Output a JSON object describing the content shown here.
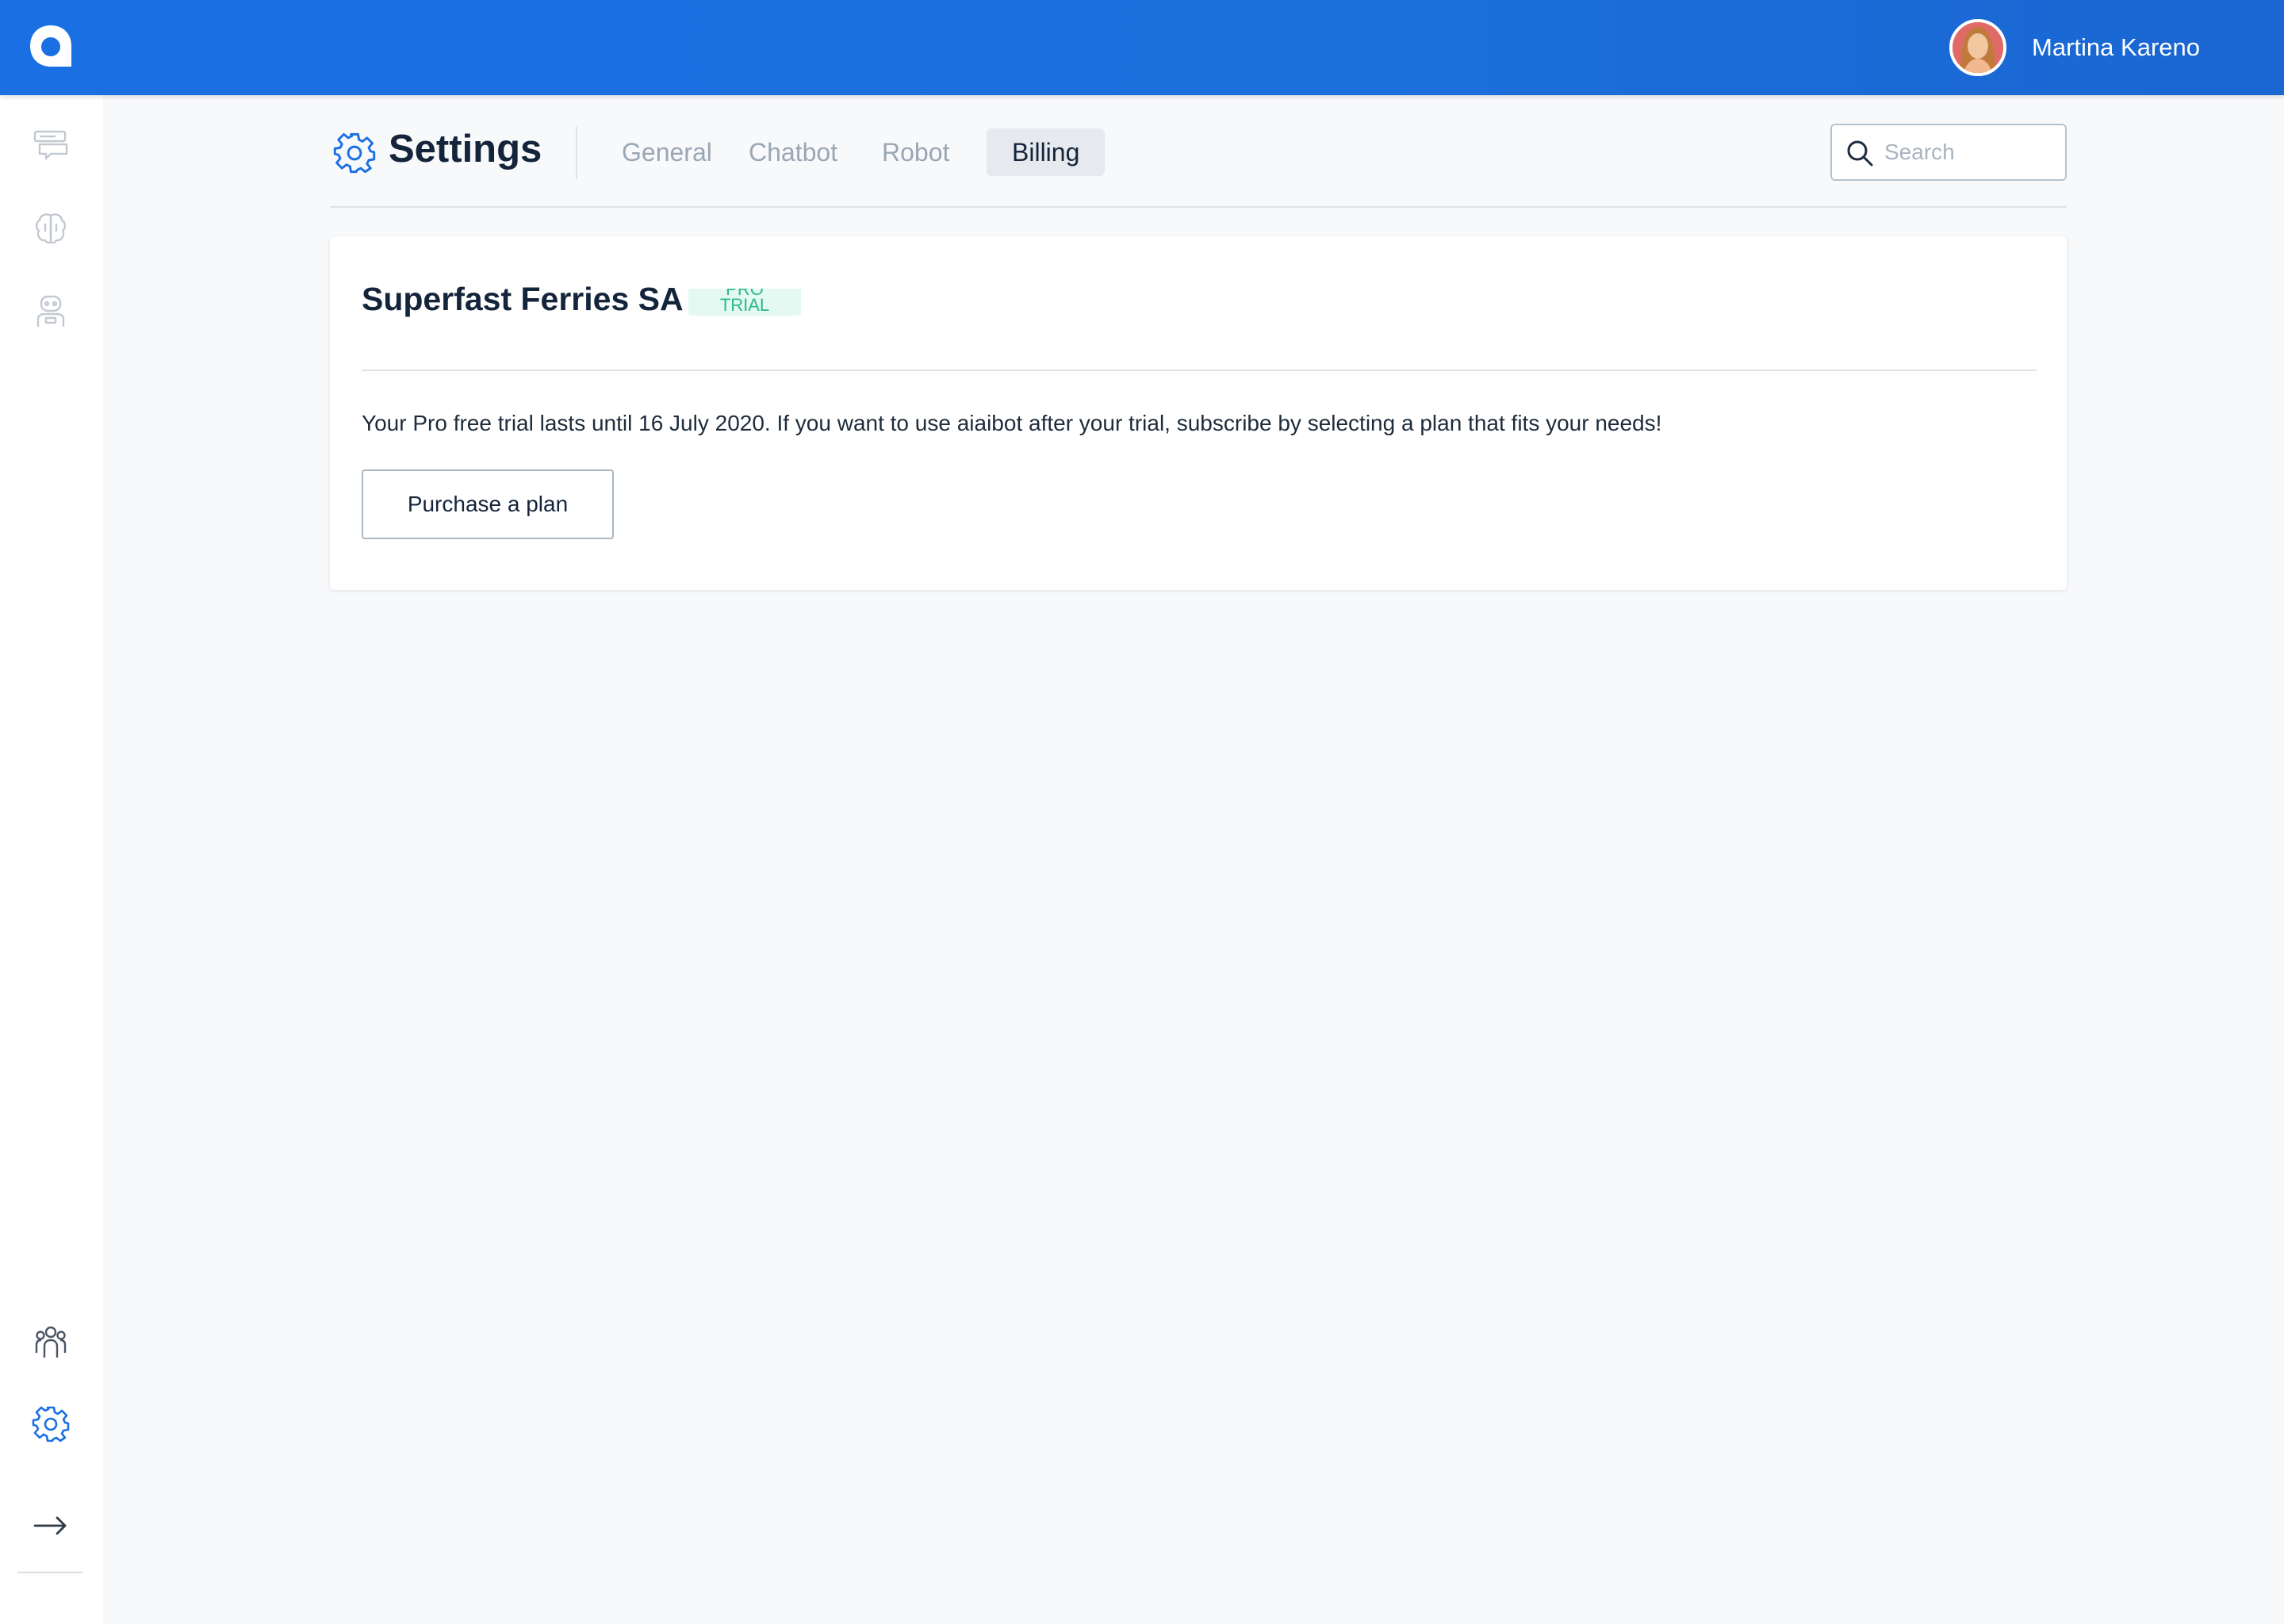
{
  "app": {
    "brand_color": "#1a70e3",
    "logo_icon": "aiaibot-logo-icon"
  },
  "user": {
    "name": "Martina Kareno",
    "avatar_icon": "user-avatar"
  },
  "sidebar": {
    "top_items": [
      {
        "icon": "conversations-icon"
      },
      {
        "icon": "brain-icon"
      },
      {
        "icon": "robot-icon"
      }
    ],
    "bottom_items": [
      {
        "icon": "team-icon"
      },
      {
        "icon": "gear-icon",
        "active": true
      },
      {
        "icon": "arrow-right-icon"
      }
    ]
  },
  "header": {
    "title": "Settings",
    "tabs": [
      {
        "label": "General",
        "active": false
      },
      {
        "label": "Chatbot",
        "active": false
      },
      {
        "label": "Robot",
        "active": false
      },
      {
        "label": "Billing",
        "active": true
      }
    ],
    "search": {
      "placeholder": "Search",
      "value": ""
    }
  },
  "billing": {
    "company_name": "Superfast Ferries SA",
    "plan_badge": {
      "line1": "PRO",
      "line2": "TRIAL",
      "color": "#2bb98a",
      "background": "#e3f9f2"
    },
    "trial_message": "Your Pro free trial lasts until 16 July 2020. If you want to use aiaibot after your trial, subscribe by selecting a plan that fits your needs!",
    "purchase_button_label": "Purchase a plan"
  }
}
